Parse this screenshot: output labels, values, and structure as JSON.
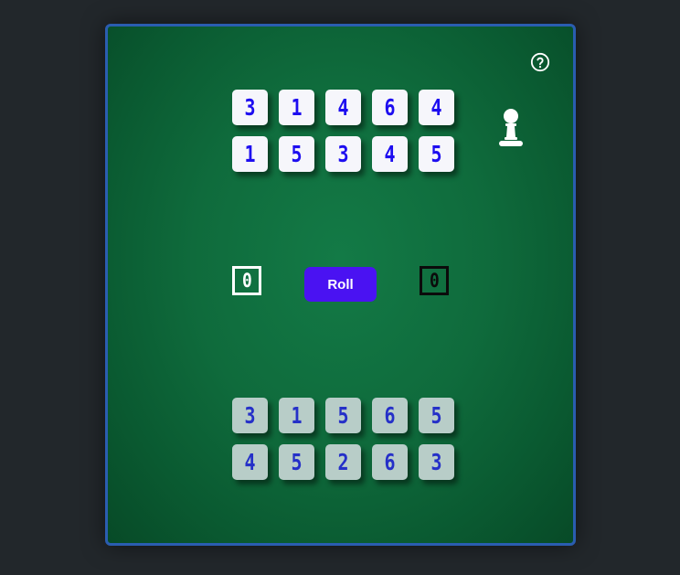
{
  "board": {
    "opponent_dice": [
      "3",
      "1",
      "4",
      "6",
      "4",
      "1",
      "5",
      "3",
      "4",
      "5"
    ],
    "player_dice": [
      "3",
      "1",
      "5",
      "6",
      "5",
      "4",
      "5",
      "2",
      "6",
      "3"
    ],
    "left_score": "0",
    "right_score": "0",
    "roll_label": "Roll"
  },
  "icons": {
    "help": "help-circle-icon",
    "pawn": "pawn-icon"
  },
  "colors": {
    "background": "#22272b",
    "board_green": "#0f6b3c",
    "board_border": "#2a5db0",
    "roll_button": "#4a12f2",
    "die_text_blue": "#1d0df0",
    "held_die_bg": "#b8cdc8"
  }
}
